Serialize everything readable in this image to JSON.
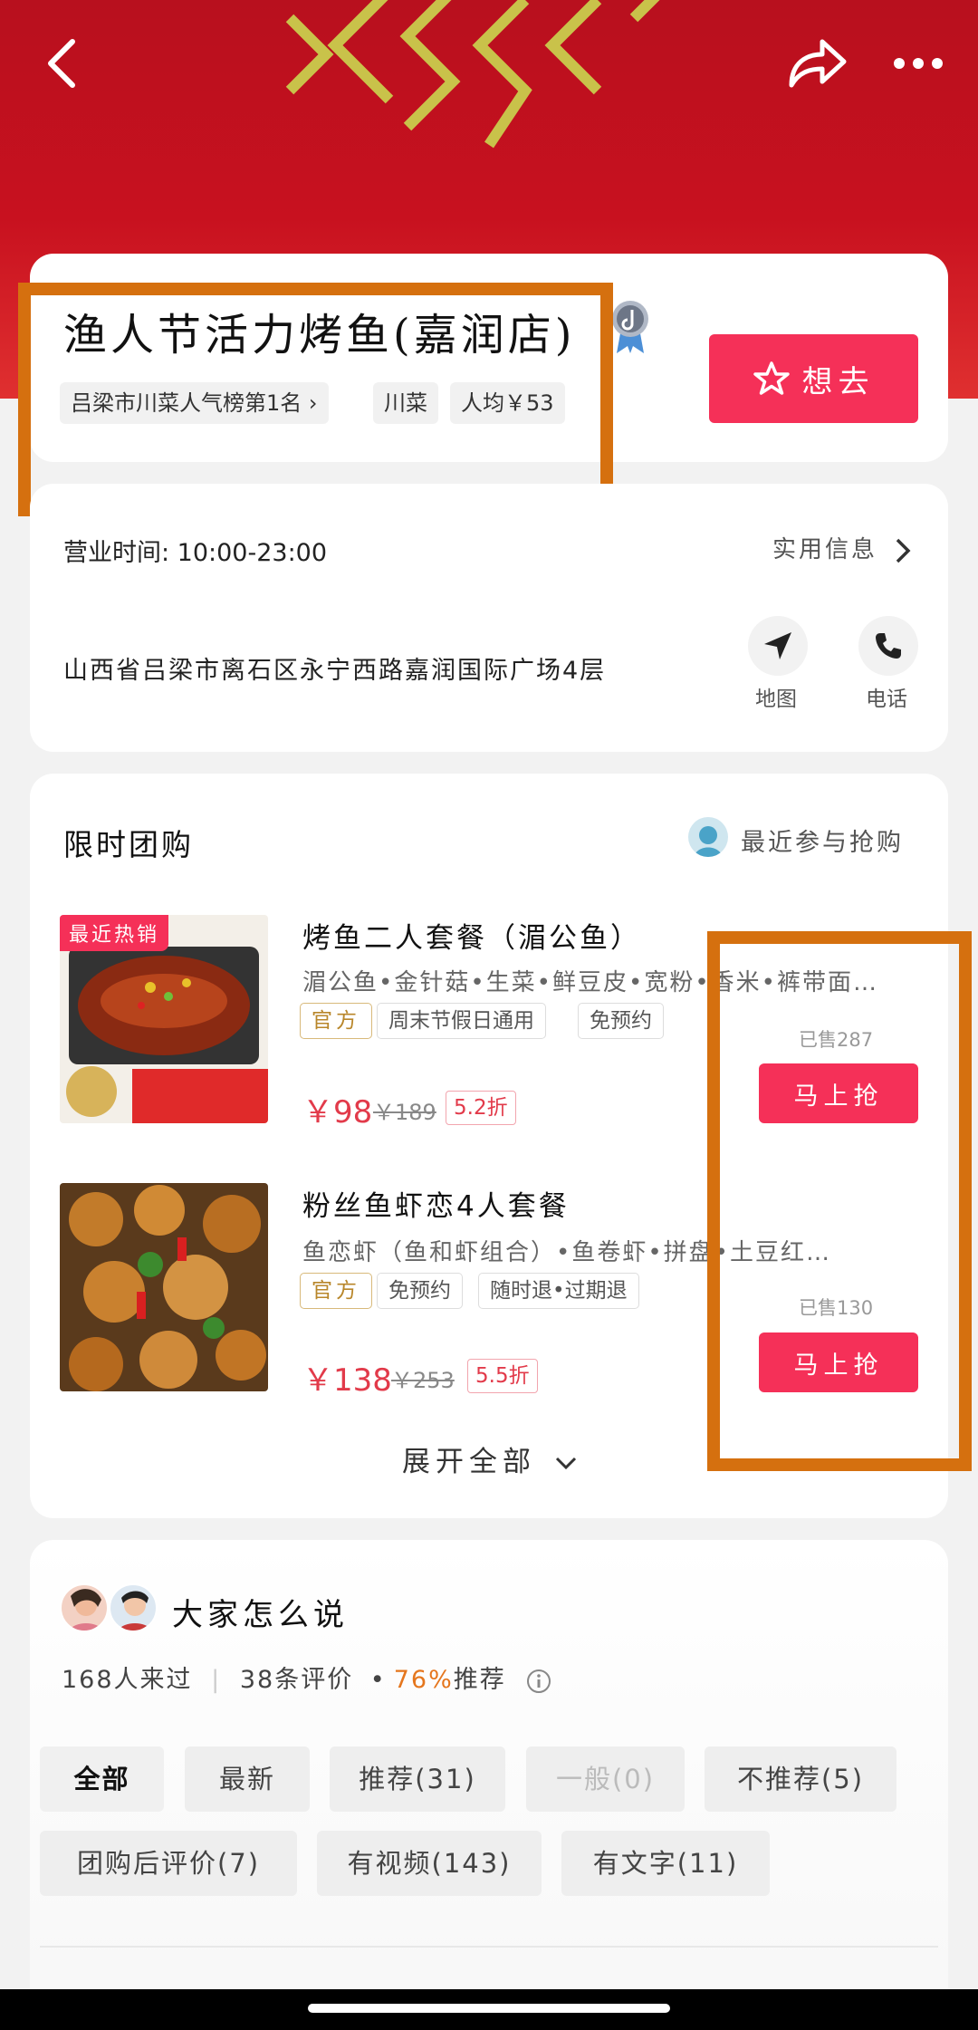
{
  "colors": {
    "brand_red": "#f53058",
    "header_red": "#c8111f",
    "highlight_box": "#d5700f",
    "accent_orange": "#e5761d",
    "price_red": "#e23a4a"
  },
  "header": {
    "back_icon": "chevron-left-icon",
    "share_icon": "share-icon",
    "more_icon": "more-icon"
  },
  "shop": {
    "name": "渔人节活力烤鱼(嘉润店)",
    "tags": [
      "吕梁市川菜人气榜第1名",
      "川菜",
      "人均￥53"
    ],
    "want_label": "想去"
  },
  "info": {
    "hours": "营业时间: 10:00-23:00",
    "practical_info": "实用信息",
    "address": "山西省吕梁市离石区永宁西路嘉润国际广场4层",
    "map_label": "地图",
    "phone_label": "电话"
  },
  "group_buy": {
    "title": "限时团购",
    "recent_buyers": "最近参与抢购",
    "expand_label": "展开全部",
    "deals": [
      {
        "badge": "最近热销",
        "name": "烤鱼二人套餐（湄公鱼）",
        "desc": "湄公鱼•金针菇•生菜•鲜豆皮•宽粉•香米•裤带面…",
        "tags": [
          "官方",
          "周末节假日通用",
          "免预约"
        ],
        "price": "￥98",
        "original_price": "￥189",
        "discount": "5.2折",
        "sold": "已售287",
        "button": "马上抢"
      },
      {
        "name": "粉丝鱼虾恋4人套餐",
        "desc": "鱼恋虾（鱼和虾组合）•鱼卷虾•拼盘•土豆红…",
        "tags": [
          "官方",
          "免预约",
          "随时退•过期退"
        ],
        "price": "￥138",
        "original_price": "￥253",
        "discount": "5.5折",
        "sold": "已售130",
        "button": "马上抢"
      }
    ]
  },
  "reviews": {
    "title": "大家怎么说",
    "visited": "168人来过",
    "count": "38条评价",
    "separator": "•",
    "recommend_pct": "76%",
    "recommend_label": "推荐",
    "filters": [
      "全部",
      "最新",
      "推荐(31)",
      "一般(0)",
      "不推荐(5)",
      "团购后评价(7)",
      "有视频(143)",
      "有文字(11)"
    ]
  }
}
